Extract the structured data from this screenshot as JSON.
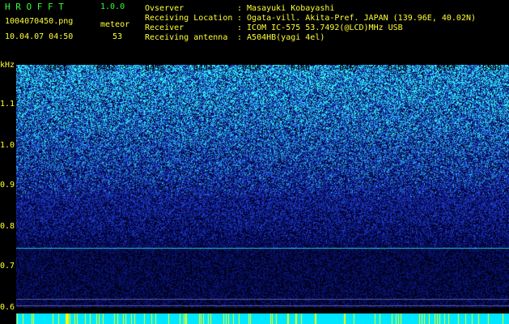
{
  "header": {
    "app_name": "H R O F F T",
    "version": "1.0.0",
    "filename": "1004070450.png",
    "datetime": "10.04.07 04:50",
    "meteor_label": "meteor",
    "meteor_count": "53"
  },
  "station": {
    "observer_label": "Ovserver",
    "observer_value": ": Masayuki Kobayashi",
    "location_label": "Receiving Location",
    "location_value": ": Ogata-vill. Akita-Pref. JAPAN (139.96E, 40.02N)",
    "receiver_label": "Receiver",
    "receiver_value": ": ICOM IC-575 53.7492(@LCD)MHz USB",
    "antenna_label": "Receiving antenna",
    "antenna_value": ": A504HB(yagi 4el)"
  },
  "plot": {
    "y_unit": "kHz",
    "y_ticks": [
      "1.1",
      "1.0",
      "0.9",
      "0.8",
      "0.7",
      "0.6"
    ],
    "x_ticks": [
      "0451",
      "0452",
      "0453",
      "0454",
      "0455",
      "0456",
      "0457",
      "0458",
      "0459",
      "0500"
    ],
    "colors": {
      "background": "#000000",
      "noise_low": "#00003c",
      "noise_mid": "#1e3cc8",
      "noise_high": "#32ffff",
      "carrier": "#28c8c8",
      "bottom_band": "#00e6ff",
      "bottom_spikes": "#ffff00"
    }
  }
}
